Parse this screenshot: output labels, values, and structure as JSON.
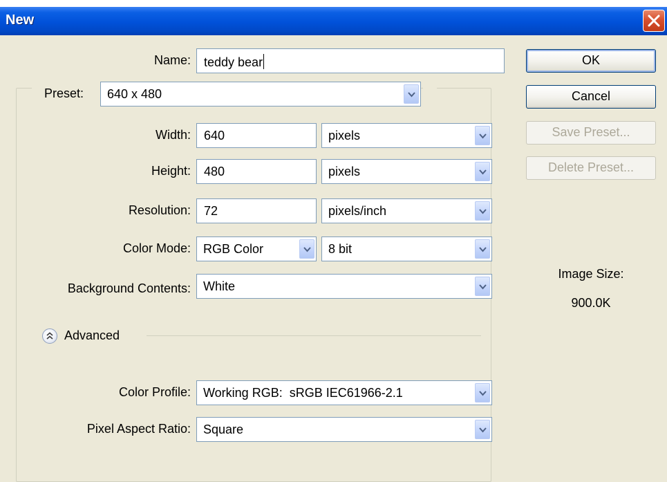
{
  "window": {
    "title": "New"
  },
  "form": {
    "name_label": "Name:",
    "name_value": "teddy bear",
    "preset_label": "Preset:",
    "preset_value": "640 x 480",
    "width_label": "Width:",
    "width_value": "640",
    "width_unit": "pixels",
    "height_label": "Height:",
    "height_value": "480",
    "height_unit": "pixels",
    "resolution_label": "Resolution:",
    "resolution_value": "72",
    "resolution_unit": "pixels/inch",
    "color_mode_label": "Color Mode:",
    "color_mode_value": "RGB Color",
    "bit_depth_value": "8 bit",
    "background_label": "Background Contents:",
    "background_value": "White"
  },
  "advanced": {
    "toggle_label": "Advanced",
    "color_profile_label": "Color Profile:",
    "color_profile_value": "Working RGB:  sRGB IEC61966-2.1",
    "pixel_aspect_label": "Pixel Aspect Ratio:",
    "pixel_aspect_value": "Square"
  },
  "buttons": {
    "ok": "OK",
    "cancel": "Cancel",
    "save_preset": "Save Preset...",
    "delete_preset": "Delete Preset..."
  },
  "image_size": {
    "label": "Image Size:",
    "value": "900.0K"
  },
  "icons": {
    "close": "close-icon",
    "dropdown": "chevron-down-icon",
    "advanced_toggle": "double-chevron-up-icon"
  },
  "colors": {
    "titlebar": "#0151d9",
    "dialog_bg": "#ece9d8",
    "close_button": "#d8502f",
    "disabled_text": "#aca899"
  }
}
